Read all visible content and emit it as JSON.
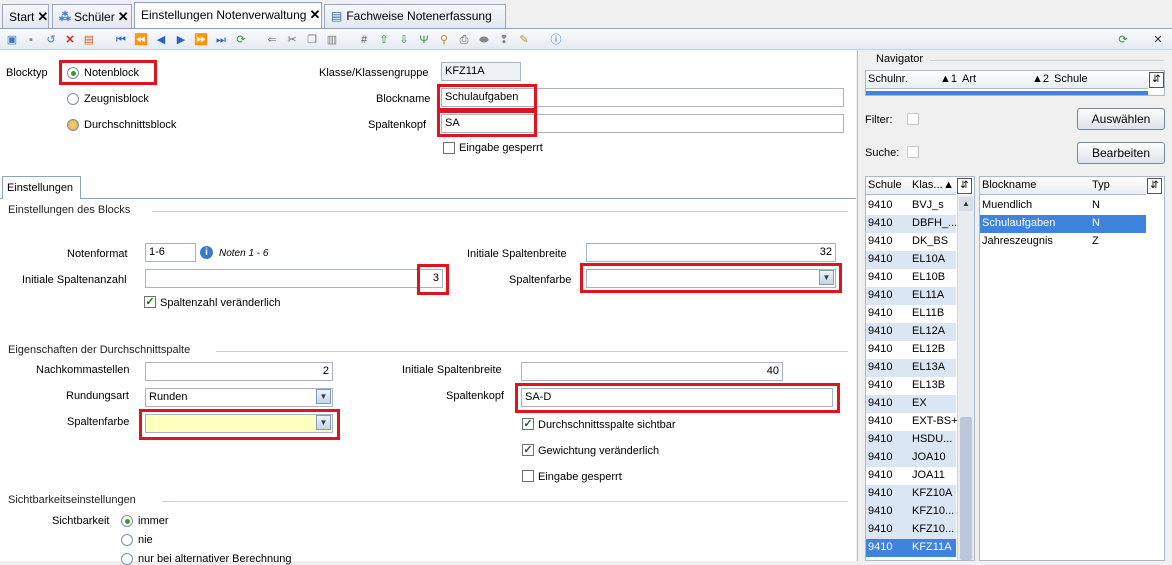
{
  "tabs": [
    {
      "label": "Start"
    },
    {
      "label": "Schüler"
    },
    {
      "label": "Einstellungen Notenverwaltung"
    },
    {
      "label": "Fachweise Notenerfassung"
    }
  ],
  "close_glyph": "✕",
  "form": {
    "blocktyp_label": "Blocktyp",
    "blocktyp_options": [
      "Notenblock",
      "Zeugnisblock",
      "Durchschnittsblock"
    ],
    "klasse_label": "Klasse/Klassengruppe",
    "klasse_value": "KFZ11A",
    "blockname_label": "Blockname",
    "blockname_value": "Schulaufgaben",
    "spaltenkopf_label": "Spaltenkopf",
    "spaltenkopf_value": "SA",
    "eingabe_gesperrt": "Eingabe gesperrt"
  },
  "settings_tab": "Einstellungen",
  "block": {
    "title": "Einstellungen des Blocks",
    "notenformat_label": "Notenformat",
    "notenformat_value": "1-6",
    "notenformat_hint": "Noten 1 - 6",
    "spaltenanzahl_label": "Initiale Spaltenanzahl",
    "spaltenanzahl_value": "3",
    "spaltenzahl_check": "Spaltenzahl veränderlich",
    "spaltenbreite_label": "Initiale Spaltenbreite",
    "spaltenbreite_value": "32",
    "spaltenfarbe_label": "Spaltenfarbe",
    "spaltenfarbe_value": ""
  },
  "avg": {
    "title": "Eigenschaften der Durchschnittspalte",
    "nachkomma_label": "Nachkommastellen",
    "nachkomma_value": "2",
    "rundung_label": "Rundungsart",
    "rundung_value": "Runden",
    "farbe_label": "Spaltenfarbe",
    "farbe_value": "",
    "breite_label": "Initiale Spaltenbreite",
    "breite_value": "40",
    "kopf_label": "Spaltenkopf",
    "kopf_value": "SA-D",
    "checks": [
      "Durchschnittsspalte sichtbar",
      "Gewichtung veränderlich",
      "Eingabe gesperrt"
    ],
    "yellow": "#ffffc0"
  },
  "visibility": {
    "title": "Sichtbarkeitseinstellungen",
    "label": "Sichtbarkeit",
    "options": [
      "immer",
      "nie",
      "nur bei alternativer Berechnung"
    ]
  },
  "navigator": {
    "title": "Navigator",
    "headers": [
      "Schulnr.",
      "1",
      "Art",
      "2",
      "Schule"
    ],
    "filter_label": "Filter:",
    "suche_label": "Suche:",
    "auswaehlen": "Auswählen",
    "bearbeiten": "Bearbeiten",
    "class_headers": [
      "Schule",
      "Klas..."
    ],
    "classes": [
      [
        "9410",
        "BVJ_s"
      ],
      [
        "9410",
        "DBFH_..."
      ],
      [
        "9410",
        "DK_BS"
      ],
      [
        "9410",
        "EL10A"
      ],
      [
        "9410",
        "EL10B"
      ],
      [
        "9410",
        "EL11A"
      ],
      [
        "9410",
        "EL11B"
      ],
      [
        "9410",
        "EL12A"
      ],
      [
        "9410",
        "EL12B"
      ],
      [
        "9410",
        "EL13A"
      ],
      [
        "9410",
        "EL13B"
      ],
      [
        "9410",
        "EX"
      ],
      [
        "9410",
        "EXT-BS+"
      ],
      [
        "9410",
        "HSDU..."
      ],
      [
        "9410",
        "JOA10"
      ],
      [
        "9410",
        "JOA11"
      ],
      [
        "9410",
        "KFZ10A"
      ],
      [
        "9410",
        "KFZ10..."
      ],
      [
        "9410",
        "KFZ10..."
      ],
      [
        "9410",
        "KFZ11A"
      ]
    ],
    "block_headers": [
      "Blockname",
      "Typ"
    ],
    "blocks": [
      [
        "Muendlich",
        "N"
      ],
      [
        "Schulaufgaben",
        "N"
      ],
      [
        "Jahreszeugnis",
        "Z"
      ]
    ]
  },
  "colors": {
    "highlight": "#e0141e",
    "selection": "#3e84de"
  }
}
